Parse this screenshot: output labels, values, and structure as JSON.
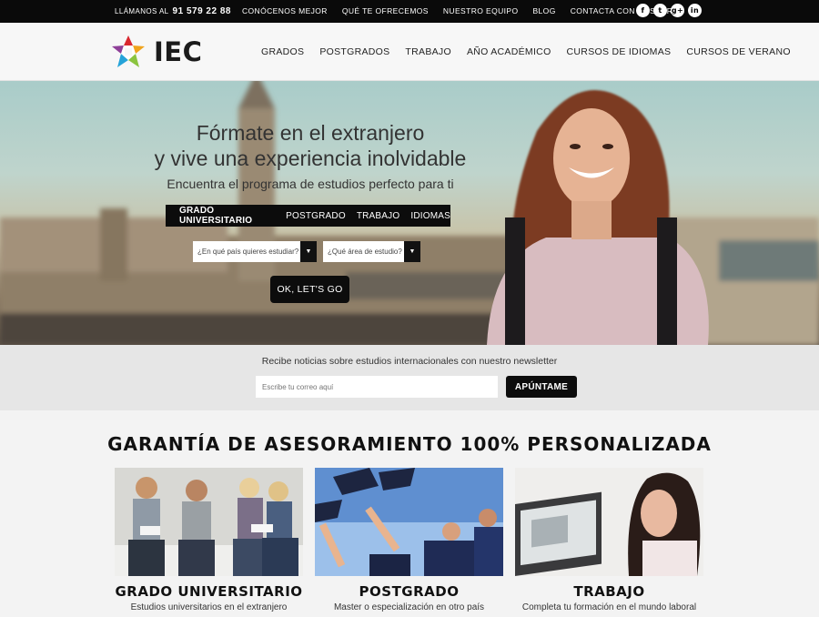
{
  "topbar": {
    "phone_label": "LLÁMANOS AL",
    "phone_number": "91 579 22 88",
    "links": [
      "CONÓCENOS MEJOR",
      "QUÉ TE OFRECEMOS",
      "NUESTRO EQUIPO",
      "BLOG",
      "CONTACTA CON NOSOTROS"
    ],
    "social": [
      "f",
      "t",
      "g+",
      "in"
    ]
  },
  "header": {
    "logo_text": "IEC",
    "nav": [
      "GRADOS",
      "POSTGRADOS",
      "TRABAJO",
      "AÑO ACADÉMICO",
      "CURSOS DE IDIOMAS",
      "CURSOS DE VERANO"
    ]
  },
  "hero": {
    "line1": "Fórmate en el extranjero",
    "line2": "y vive una experiencia inolvidable",
    "subtitle": "Encuentra el programa de estudios perfecto para ti",
    "tabs": [
      "GRADO UNIVERSITARIO",
      "POSTGRADO",
      "TRABAJO",
      "IDIOMAS"
    ],
    "country_select": "¿En qué país quieres estudiar?",
    "area_select": "¿Qué área de estudio?",
    "cta": "OK, LET'S GO"
  },
  "newsletter": {
    "text": "Recibe noticias sobre estudios internacionales con nuestro newsletter",
    "placeholder": "Escribe tu correo aquí",
    "button": "APÚNTAME"
  },
  "guarantee_title": "GARANTÍA DE ASESORAMIENTO 100% PERSONALIZADA",
  "cards": [
    {
      "title": "GRADO UNIVERSITARIO",
      "subtitle": "Estudios universitarios en el extranjero"
    },
    {
      "title": "POSTGRADO",
      "subtitle": "Master o especialización en otro país"
    },
    {
      "title": "TRABAJO",
      "subtitle": "Completa tu formación en el mundo laboral"
    }
  ]
}
